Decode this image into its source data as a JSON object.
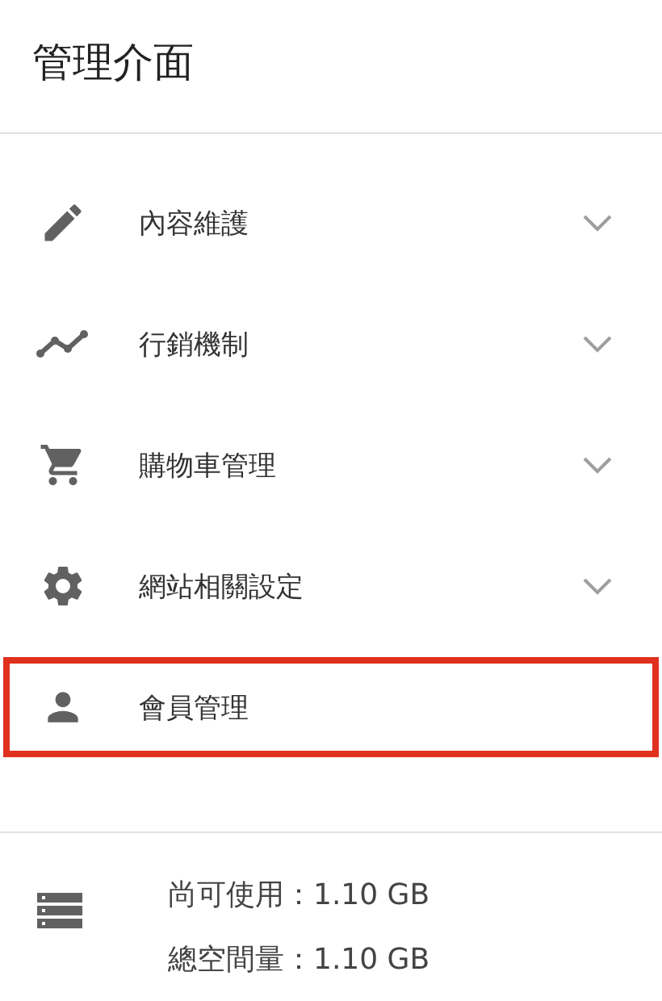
{
  "title": "管理介面",
  "menu": [
    {
      "label": "內容維護",
      "kind": "pencil",
      "expandable": true,
      "selected": false
    },
    {
      "label": "行銷機制",
      "kind": "chart",
      "expandable": true,
      "selected": false
    },
    {
      "label": "購物車管理",
      "kind": "cart",
      "expandable": true,
      "selected": false
    },
    {
      "label": "網站相關設定",
      "kind": "gear",
      "expandable": true,
      "selected": false
    },
    {
      "label": "會員管理",
      "kind": "person",
      "expandable": false,
      "selected": true
    }
  ],
  "storage": {
    "available": "尚可使用：1.10 GB",
    "total": "總空間量：1.10 GB"
  }
}
